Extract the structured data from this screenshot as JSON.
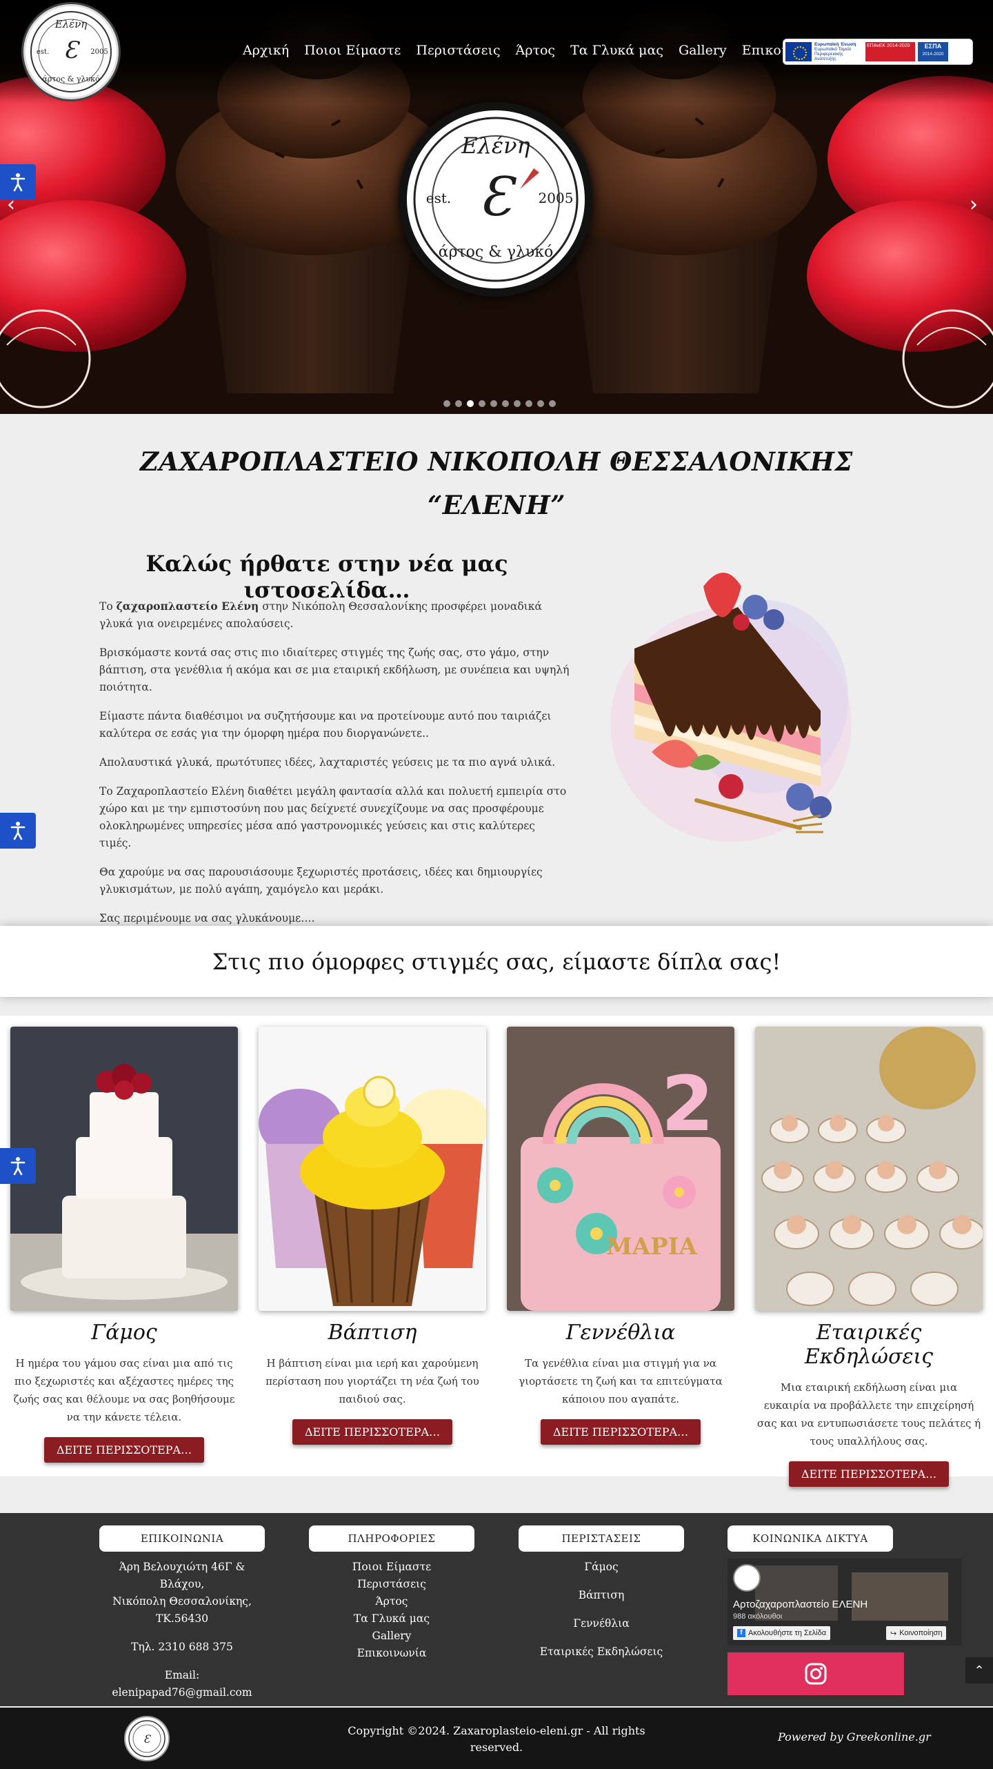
{
  "logo": {
    "script_name": "Ελένη",
    "est": "est.",
    "year": "2005",
    "tagline": "άρτος & γλυκό"
  },
  "nav": [
    {
      "label": "Αρχική"
    },
    {
      "label": "Ποιοι Είμαστε"
    },
    {
      "label": "Περιστάσεις"
    },
    {
      "label": "Άρτος"
    },
    {
      "label": "Τα Γλυκά μας"
    },
    {
      "label": "Gallery"
    },
    {
      "label": "Επικοινωνία"
    }
  ],
  "eu_banner": {
    "eu": "Ευρωπαϊκή Ένωση",
    "eu_sub": "Ευρωπαϊκό Ταμείο Περιφερειακής Ανάπτυξης",
    "epanek": "ΕΠΑνΕΚ 2014-2020",
    "espa": "ΕΣΠΑ",
    "espa_years": "2014-2020"
  },
  "slider": {
    "prev_icon": "chevron-left-icon",
    "next_icon": "chevron-right-icon",
    "slide_count": 10,
    "active_index": 2
  },
  "welcome": {
    "title_line1": "ΖΑΧΑΡΟΠΛΑΣΤΕΙΟ ΝΙΚΟΠΟΛΗ ΘΕΣΣΑΛΟΝΙΚΗΣ",
    "title_line2": "“ΕΛΕΝΗ”",
    "heading": "Καλώς ήρθατε στην νέα μας ιστοσελίδα…",
    "p1_prefix": "Το ",
    "p1_bold": "ζαχαροπλαστείο Ελένη",
    "p1_suffix": " στην Νικόπολη Θεσσαλονίκης προσφέρει μοναδικά γλυκά για ονειρεμένες απολαύσεις.",
    "p2": "Βρισκόμαστε κοντά σας στις πιο ιδιαίτερες στιγμές της ζωής σας, στο γάμο, στην βάπτιση, στα γενέθλια ή ακόμα και σε μια εταιρική εκδήλωση, με συνέπεια και υψηλή ποιότητα.",
    "p3": "Είμαστε πάντα διαθέσιμοι να συζητήσουμε και να προτείνουμε αυτό που ταιριάζει καλύτερα σε εσάς για την όμορφη ημέρα που διοργανώνετε..",
    "p4": "Απολαυστικά γλυκά, πρωτότυπες ιδέες, λαχταριστές γεύσεις με τα πιο αγνά υλικά.",
    "p5": "Το Ζαχαροπλαστείο Ελένη διαθέτει μεγάλη φαντασία αλλά και πολυετή εμπειρία στο χώρο και με την εμπιστοσύνη που μας δείχνετέ συνεχίζουμε να σας προσφέρουμε ολοκληρωμένες υπηρεσίες μέσα από γαστρονομικές γεύσεις και στις καλύτερες τιμές.",
    "p6": "Θα χαρούμε να σας παρουσιάσουμε ξεχωριστές προτάσεις, ιδέες και δημιουργίες γλυκισμάτων, με πολύ αγάπη, χαμόγελο και μεράκι.",
    "p7": "Σας περιμένουμε να σας γλυκάνουμε…."
  },
  "slogan": "Στις πιο όμορφες στιγμές σας, είμαστε δίπλα σας!",
  "services": [
    {
      "title": "Γάμος",
      "text": "Η ημέρα του γάμου σας είναι μια από τις πιο ξεχωριστές και αξέχαστες ημέρες της ζωής σας και θέλουμε να σας βοηθήσουμε να την κάνετε τέλεια.",
      "button": "ΔΕΙΤΕ ΠΕΡΙΣΣΟΤΕΡΑ…"
    },
    {
      "title": "Βάπτιση",
      "text": "Η βάπτιση είναι μια ιερή και χαρούμενη περίσταση που γιορτάζει τη νέα ζωή του παιδιού σας.",
      "button": "ΔΕΙΤΕ ΠΕΡΙΣΣΟΤΕΡΑ…"
    },
    {
      "title": "Γεννέθλια",
      "text": "Τα γενέθλια είναι μια στιγμή για να γιορτάσετε τη ζωή και τα επιτεύγματα κάποιου που αγαπάτε.",
      "button": "ΔΕΙΤΕ ΠΕΡΙΣΣΟΤΕΡΑ…",
      "cake_text": "ΜΑΡΙΑ",
      "cake_number": "2"
    },
    {
      "title": "Εταιρικές Εκδηλώσεις",
      "text": "Μια εταιρική εκδήλωση είναι μια ευκαιρία να προβάλλετε την επιχείρησή σας και να εντυπωσιάσετε τους πελάτες ή τους υπαλλήλους σας.",
      "button": "ΔΕΙΤΕ ΠΕΡΙΣΣΟΤΕΡΑ…"
    }
  ],
  "footer": {
    "contact": {
      "heading": "ΕΠΙΚΟΙΝΩΝΙΑ",
      "addr1": "Άρη Βελουχιώτη 46Γ & Βλάχου,",
      "addr2": "Νικόπολη Θεσσαλονίκης,",
      "addr3": "ΤΚ.56430",
      "phone": "Τηλ. 2310 688 375",
      "email_label": "Email:",
      "email": "elenipapad76@gmail.com"
    },
    "info": {
      "heading": "ΠΛΗΡΟΦΟΡΙΕΣ",
      "links": [
        "Ποιοι Είμαστε",
        "Περιστάσεις",
        "Άρτος",
        "Τα Γλυκά μας",
        "Gallery",
        "Επικοινωνία"
      ]
    },
    "occasions": {
      "heading": "ΠΕΡΙΣΤΑΣΕΙΣ",
      "links": [
        "Γάμος",
        "Βάπτιση",
        "Γεννέθλια",
        "Εταιρικές Εκδηλώσεις"
      ]
    },
    "social": {
      "heading": "ΚΟΙΝΩΝΙΚΑ ΔΙΚΤΥΑ",
      "fb_page": "Αρτοζαχαροπλαστείο ΕΛΕΝΗ",
      "fb_followers": "988 ακόλουθοι",
      "fb_follow": "Ακολουθήστε τη Σελίδα",
      "fb_share": "Κοινοποίηση"
    }
  },
  "bottom": {
    "copyright_line1": "Copyright ©2024. Zaxaroplasteio-eleni.gr - All rights",
    "copyright_line2": "reserved.",
    "powered": "Powered by Greekonline.gr"
  },
  "colors": {
    "accent_button": "#8b1c22",
    "a11y": "#1e50c8",
    "footer_bg": "#333333",
    "bottom_bg": "#151515",
    "instagram": "#e02f5d"
  }
}
